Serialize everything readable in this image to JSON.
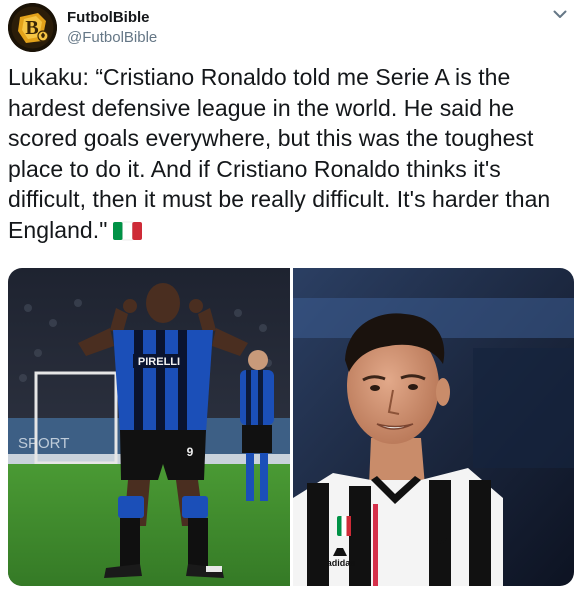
{
  "author": {
    "display_name": "FutbolBible",
    "handle": "@FutbolBible",
    "avatar_icon": "futbolbible-logo"
  },
  "menu_icon": "chevron-down-icon",
  "tweet": {
    "text": "Lukaku: “Cristiano Ronaldo told me Serie A is the hardest defensive league in the world. He said he scored goals everywhere, but this was the toughest place to do it. And if Cristiano Ronaldo thinks it's difficult, then it must be really difficult. It's harder than England.\"",
    "flag_emoji": "italy-flag",
    "flag_colors": [
      "#009246",
      "#ffffff",
      "#ce2b37"
    ]
  },
  "media": {
    "left_photo": {
      "subject": "Inter Milan player celebrating with hands at ears",
      "jersey_sponsor": "PIRELLI",
      "shirt_number": "9"
    },
    "right_photo": {
      "subject": "Juventus player smiling",
      "kit_brand": "adidas"
    }
  },
  "colors": {
    "text": "#14171a",
    "secondary_text": "#657786",
    "inter_blue": "#1b4fb8",
    "pitch_green": "#3f8f2e"
  }
}
